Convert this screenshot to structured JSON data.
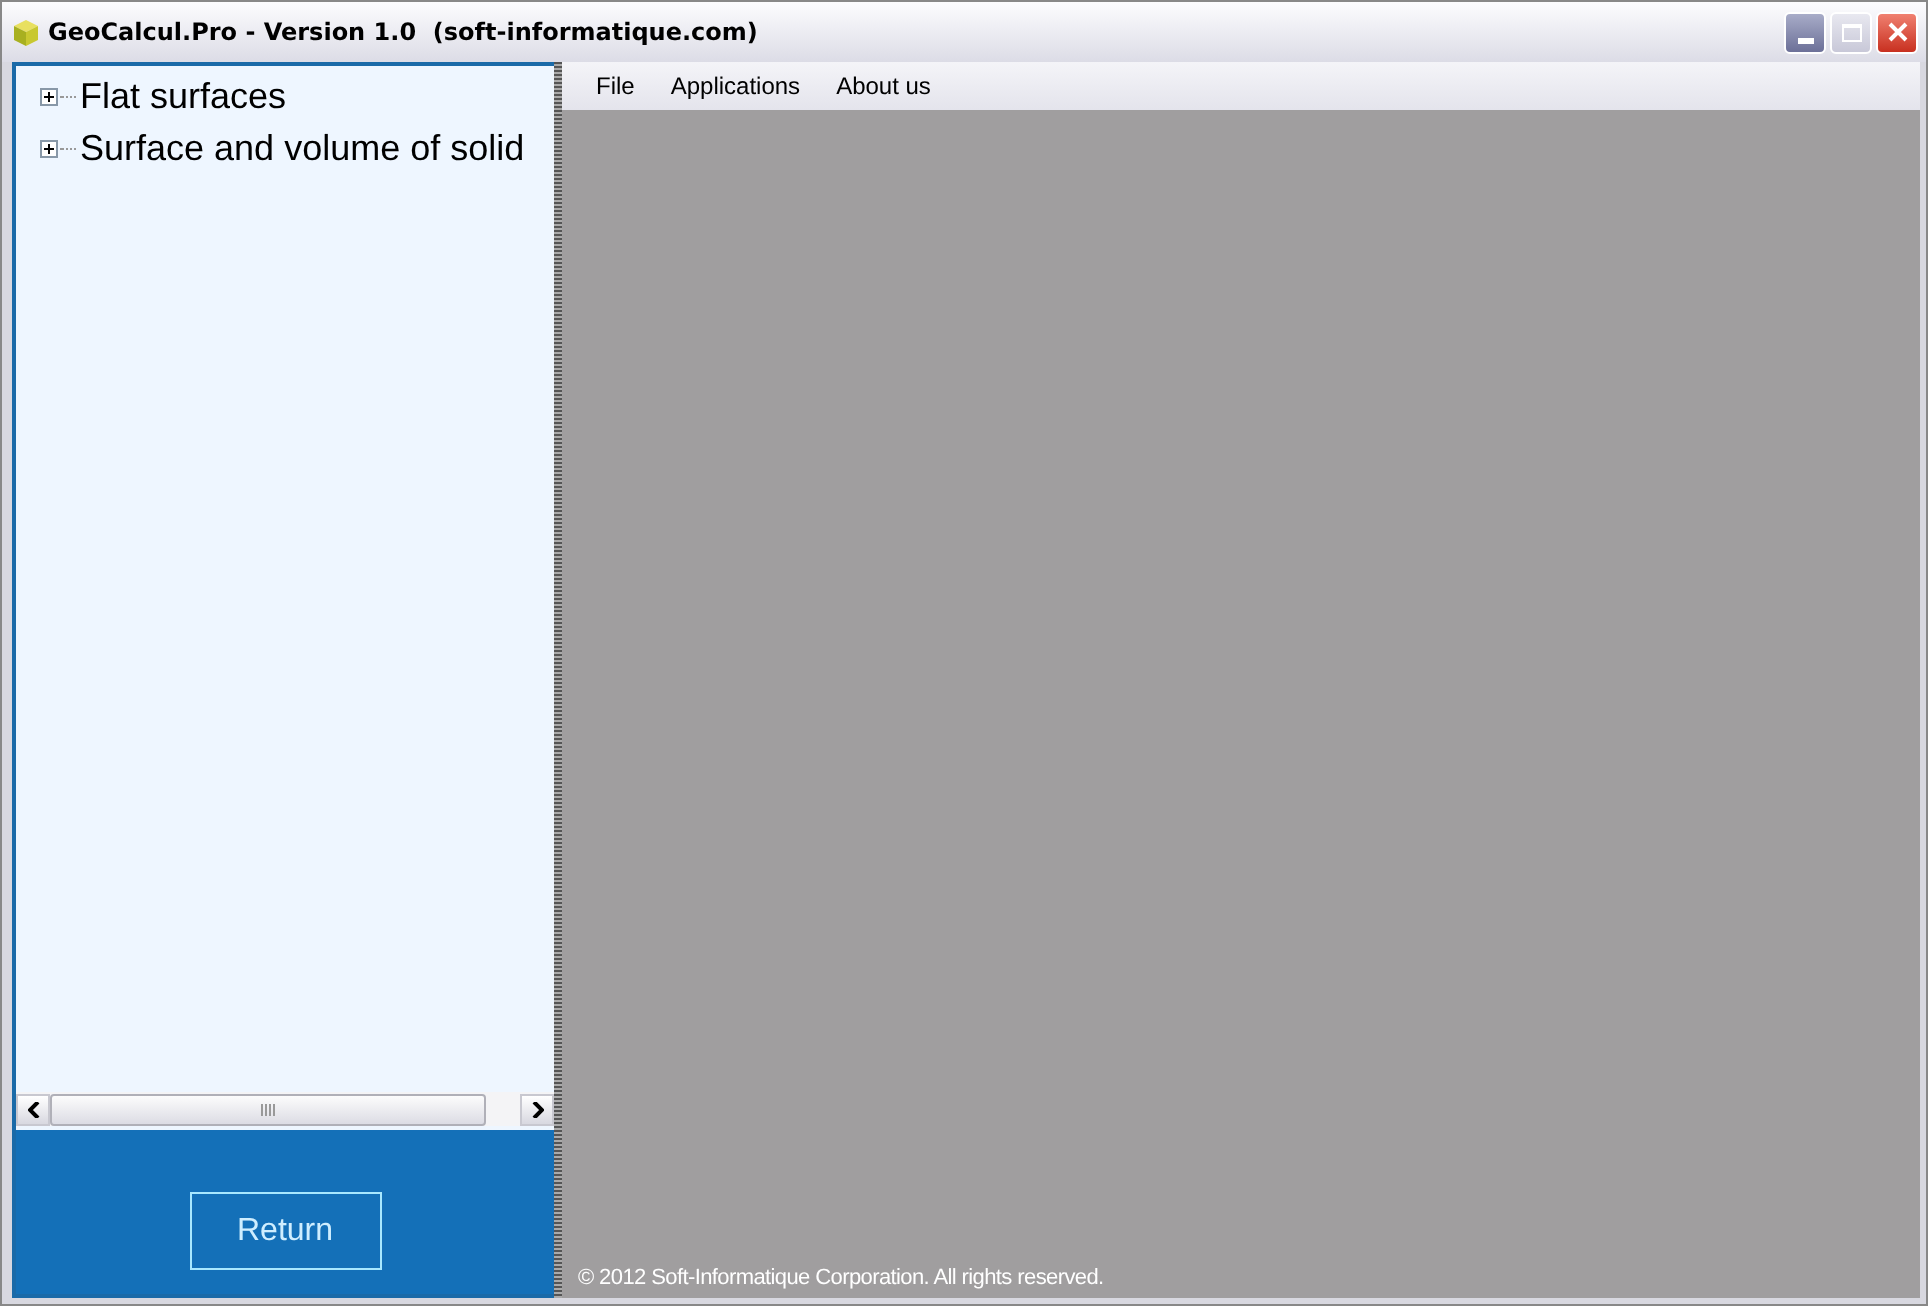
{
  "window": {
    "title": "GeoCalcul.Pro - Version 1.0  (soft-informatique.com)"
  },
  "tree": [
    {
      "label": "Flat surfaces",
      "expanded": false
    },
    {
      "label": "Surface and volume of solid",
      "expanded": false
    }
  ],
  "menu": [
    "File",
    "Applications",
    "About us"
  ],
  "return_button": "Return",
  "footer": "© 2012 Soft-Informatique Corporation. All rights reserved."
}
